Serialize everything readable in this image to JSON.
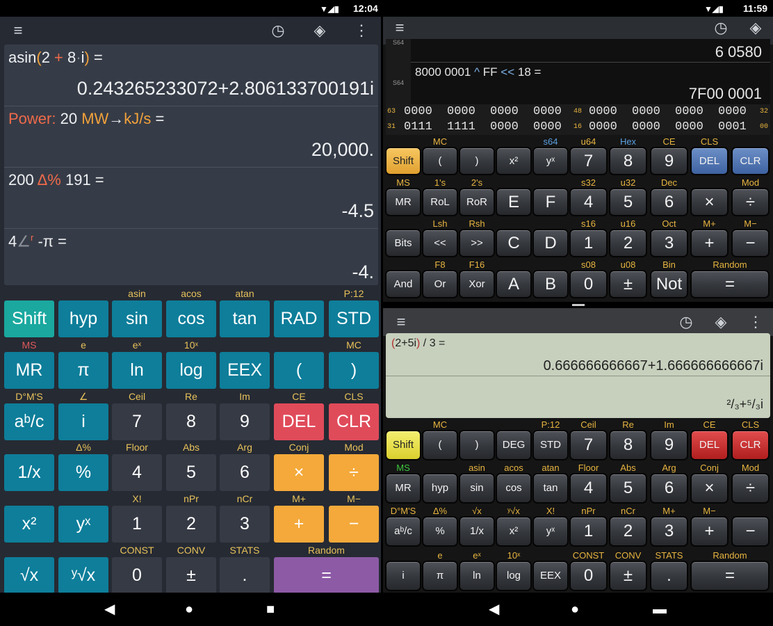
{
  "left": {
    "status": {
      "time": "12:04"
    },
    "toolbar": {
      "menu_icon": "hamburger-icon",
      "history_icon": "clock-icon",
      "layers_icon": "layers-icon",
      "more_icon": "more-vert-icon"
    },
    "display": [
      {
        "parts": [
          {
            "t": "asin",
            "c": "#eef0f2"
          },
          {
            "t": "(",
            "c": "#f2a13b"
          },
          {
            "t": "2 ",
            "c": "#eef0f2"
          },
          {
            "t": "+",
            "c": "#ef6a4a"
          },
          {
            "t": " 8",
            "c": "#eef0f2"
          },
          {
            "t": "·",
            "c": "#8b8f96"
          },
          {
            "t": "i",
            "c": "#eef0f2"
          },
          {
            "t": ")",
            "c": "#f2a13b"
          },
          {
            "t": " =",
            "c": "#eef0f2"
          }
        ],
        "result": "0.243265233072+2.806133700191i"
      },
      {
        "parts": [
          {
            "t": "Power:",
            "c": "#ef6a4a"
          },
          {
            "t": " 20 ",
            "c": "#eef0f2"
          },
          {
            "t": "MW",
            "c": "#f2a13b"
          },
          {
            "t": "→",
            "c": "#eef0f2"
          },
          {
            "t": "kJ/s",
            "c": "#f2a13b"
          },
          {
            "t": " =",
            "c": "#eef0f2"
          }
        ],
        "result": "20,000."
      },
      {
        "parts": [
          {
            "t": "200 ",
            "c": "#eef0f2"
          },
          {
            "t": "Δ%",
            "c": "#ef6a4a"
          },
          {
            "t": " 191 =",
            "c": "#eef0f2"
          }
        ],
        "result": "-4.5"
      },
      {
        "parts": [
          {
            "t": "4",
            "c": "#eef0f2"
          },
          {
            "t": "∠",
            "c": "#8b8f96"
          },
          {
            "t": "r",
            "c": "#ef6a4a",
            "sup": true
          },
          {
            "t": " -π =",
            "c": "#eef0f2"
          }
        ],
        "result": "-4."
      }
    ],
    "rows": [
      {
        "labels": [
          [
            "",
            ""
          ],
          [
            "",
            ""
          ],
          [
            "asin",
            "#e8c25a"
          ],
          [
            "acos",
            "#e8c25a"
          ],
          [
            "atan",
            "#e8c25a"
          ],
          [
            "",
            ""
          ],
          [
            "P:12",
            "#e8c25a"
          ]
        ],
        "buttons": [
          [
            "Shift",
            "#1aa89f"
          ],
          [
            "hyp",
            "#0e7e9a"
          ],
          [
            "sin",
            "#0e7e9a"
          ],
          [
            "cos",
            "#0e7e9a"
          ],
          [
            "tan",
            "#0e7e9a"
          ],
          [
            "RAD",
            "#0e7e9a"
          ],
          [
            "STD",
            "#0e7e9a"
          ]
        ]
      },
      {
        "labels": [
          [
            "MS",
            "#e05a5a"
          ],
          [
            "e",
            "#e8c25a"
          ],
          [
            "eˣ",
            "#e8c25a"
          ],
          [
            "10ˣ",
            "#e8c25a"
          ],
          [
            "",
            ""
          ],
          [
            "",
            ""
          ],
          [
            "MC",
            "#e8c25a"
          ]
        ],
        "buttons": [
          [
            "MR",
            "#0e7e9a"
          ],
          [
            "π",
            "#0e7e9a"
          ],
          [
            "ln",
            "#0e7e9a"
          ],
          [
            "log",
            "#0e7e9a"
          ],
          [
            "EEX",
            "#0e7e9a"
          ],
          [
            "(",
            "#0e7e9a"
          ],
          [
            ")",
            "#0e7e9a"
          ]
        ]
      },
      {
        "labels": [
          [
            "D°M'S",
            "#e8c25a"
          ],
          [
            "∠",
            "#e8c25a"
          ],
          [
            "Ceil",
            "#e8c25a"
          ],
          [
            "Re",
            "#e8c25a"
          ],
          [
            "Im",
            "#e8c25a"
          ],
          [
            "CE",
            "#e8c25a"
          ],
          [
            "CLS",
            "#e8c25a"
          ]
        ],
        "buttons": [
          [
            "aᵇ/c",
            "#0e7e9a"
          ],
          [
            "i",
            "#0e7e9a"
          ],
          [
            "7",
            "#363a44"
          ],
          [
            "8",
            "#363a44"
          ],
          [
            "9",
            "#363a44"
          ],
          [
            "DEL",
            "#e04b5a"
          ],
          [
            "CLR",
            "#e04b5a"
          ]
        ]
      },
      {
        "labels": [
          [
            "",
            ""
          ],
          [
            "Δ%",
            "#e8c25a"
          ],
          [
            "Floor",
            "#e8c25a"
          ],
          [
            "Abs",
            "#e8c25a"
          ],
          [
            "Arg",
            "#e8c25a"
          ],
          [
            "Conj",
            "#e8c25a"
          ],
          [
            "Mod",
            "#e8c25a"
          ]
        ],
        "buttons": [
          [
            "1/x",
            "#0e7e9a"
          ],
          [
            "%",
            "#0e7e9a"
          ],
          [
            "4",
            "#363a44"
          ],
          [
            "5",
            "#363a44"
          ],
          [
            "6",
            "#363a44"
          ],
          [
            "×",
            "#f4a93a"
          ],
          [
            "÷",
            "#f4a93a"
          ]
        ]
      },
      {
        "labels": [
          [
            "",
            ""
          ],
          [
            "",
            ""
          ],
          [
            "X!",
            "#e8c25a"
          ],
          [
            "nPr",
            "#e8c25a"
          ],
          [
            "nCr",
            "#e8c25a"
          ],
          [
            "M+",
            "#e8c25a"
          ],
          [
            "M−",
            "#e8c25a"
          ]
        ],
        "buttons": [
          [
            "x²",
            "#0e7e9a"
          ],
          [
            "yˣ",
            "#0e7e9a"
          ],
          [
            "1",
            "#363a44"
          ],
          [
            "2",
            "#363a44"
          ],
          [
            "3",
            "#363a44"
          ],
          [
            "+",
            "#f4a93a"
          ],
          [
            "−",
            "#f4a93a"
          ]
        ]
      },
      {
        "labels": [
          [
            "",
            ""
          ],
          [
            "",
            ""
          ],
          [
            "CONST",
            "#e8c25a"
          ],
          [
            "CONV",
            "#e8c25a"
          ],
          [
            "STATS",
            "#e8c25a"
          ],
          [
            "Random",
            "#e8c25a"
          ],
          [
            "",
            ""
          ]
        ],
        "buttons": [
          [
            "√x",
            "#0e7e9a"
          ],
          [
            "ʸ√x",
            "#0e7e9a"
          ],
          [
            "0",
            "#363a44"
          ],
          [
            "±",
            "#363a44"
          ],
          [
            ".",
            "#363a44"
          ],
          [
            "=",
            "#8d5aa6"
          ]
        ]
      }
    ],
    "nav": {
      "back": "◀",
      "home": "●",
      "recent": "■"
    }
  },
  "topright": {
    "status": {
      "time": "11:59"
    },
    "display": {
      "s64_a": "S64",
      "line1": "6 0580",
      "expr": [
        {
          "t": "8000 0001 ",
          "c": "#e6e6e6"
        },
        {
          "t": "^",
          "c": "#7fb0e6"
        },
        {
          "t": " FF ",
          "c": "#e6e6e6"
        },
        {
          "t": "<<",
          "c": "#7fb0e6"
        },
        {
          "t": " 18 =",
          "c": "#e6e6e6"
        }
      ],
      "s64_b": "S64",
      "result": "7F00 0001"
    },
    "bits": {
      "row1": {
        "l": "63",
        "a": "0000",
        "b": "0000",
        "c": "0000",
        "d": "0000",
        "m": "48",
        "e": "0000",
        "f": "0000",
        "g": "0000",
        "h": "0000",
        "r": "32"
      },
      "row2": {
        "l": "31",
        "a": "0111",
        "b": "1111",
        "c": "0000",
        "d": "0000",
        "m": "16",
        "e": "0000",
        "f": "0000",
        "g": "0000",
        "h": "0001",
        "r": "00"
      }
    },
    "rows": [
      {
        "labels": [
          [
            "",
            ""
          ],
          [
            "MC",
            "#e8b540"
          ],
          [
            "",
            ""
          ],
          [
            "",
            ""
          ],
          [
            "s64",
            "#5aa0e0"
          ],
          [
            "u64",
            "#e8b540"
          ],
          [
            "Hex",
            "#5aa0e0"
          ],
          [
            "CE",
            "#e8b540"
          ],
          [
            "CLS",
            "#e8b540"
          ]
        ],
        "buttons": [
          [
            "Shift",
            "y"
          ],
          [
            "(",
            ""
          ],
          [
            ")",
            ""
          ],
          [
            "x²",
            ""
          ],
          [
            "yˣ",
            ""
          ],
          [
            "7",
            "num"
          ],
          [
            "8",
            "num"
          ],
          [
            "9",
            "num"
          ],
          [
            "DEL",
            "b"
          ],
          [
            "CLR",
            "b"
          ]
        ]
      },
      {
        "labels": [
          [
            "MS",
            "#e8b540"
          ],
          [
            "1's",
            "#e8b540"
          ],
          [
            "2's",
            "#e8b540"
          ],
          [
            "",
            ""
          ],
          [
            "",
            ""
          ],
          [
            "s32",
            "#e8b540"
          ],
          [
            "u32",
            "#e8b540"
          ],
          [
            "Dec",
            "#e8b540"
          ],
          [
            "",
            ""
          ],
          [
            "Mod",
            "#e8b540"
          ]
        ],
        "buttons": [
          [
            "MR",
            ""
          ],
          [
            "RoL",
            ""
          ],
          [
            "RoR",
            ""
          ],
          [
            "E",
            "num"
          ],
          [
            "F",
            "num"
          ],
          [
            "4",
            "num"
          ],
          [
            "5",
            "num"
          ],
          [
            "6",
            "num"
          ],
          [
            "×",
            "num"
          ],
          [
            "÷",
            "num"
          ]
        ]
      },
      {
        "labels": [
          [
            "",
            ""
          ],
          [
            "Lsh",
            "#e8b540"
          ],
          [
            "Rsh",
            "#e8b540"
          ],
          [
            "",
            ""
          ],
          [
            "",
            ""
          ],
          [
            "s16",
            "#e8b540"
          ],
          [
            "u16",
            "#e8b540"
          ],
          [
            "Oct",
            "#e8b540"
          ],
          [
            "M+",
            "#e8b540"
          ],
          [
            "M−",
            "#e8b540"
          ]
        ],
        "buttons": [
          [
            "Bits",
            ""
          ],
          [
            "<<",
            ""
          ],
          [
            ">>",
            ""
          ],
          [
            "C",
            "num"
          ],
          [
            "D",
            "num"
          ],
          [
            "1",
            "num"
          ],
          [
            "2",
            "num"
          ],
          [
            "3",
            "num"
          ],
          [
            "+",
            "num"
          ],
          [
            "−",
            "num"
          ]
        ]
      },
      {
        "labels": [
          [
            "",
            ""
          ],
          [
            "F8",
            "#e8b540"
          ],
          [
            "F16",
            "#e8b540"
          ],
          [
            "",
            ""
          ],
          [
            "",
            ""
          ],
          [
            "s08",
            "#e8b540"
          ],
          [
            "u08",
            "#e8b540"
          ],
          [
            "Bin",
            "#e8b540"
          ],
          [
            "Random",
            "#e8b540"
          ]
        ],
        "buttons": [
          [
            "And",
            ""
          ],
          [
            "Or",
            ""
          ],
          [
            "Xor",
            ""
          ],
          [
            "A",
            "num"
          ],
          [
            "B",
            "num"
          ],
          [
            "0",
            "num"
          ],
          [
            "±",
            "num"
          ],
          [
            "Not",
            "num"
          ],
          [
            "=",
            "num"
          ]
        ]
      }
    ]
  },
  "bottomright": {
    "display": {
      "expr": [
        {
          "t": "(",
          "c": "#b03030"
        },
        {
          "t": "2+5i",
          "c": "#222"
        },
        {
          "t": ")",
          "c": "#b03030"
        },
        {
          "t": " / 3 =",
          "c": "#222"
        }
      ],
      "result": "0.666666666667+1.666666666667i",
      "frac": "²/₃+⁵/₃i"
    },
    "rows": [
      {
        "labels": [
          [
            "",
            ""
          ],
          [
            "MC",
            "#e8b540"
          ],
          [
            "",
            ""
          ],
          [
            "",
            ""
          ],
          [
            "P:12",
            "#e8b540"
          ],
          [
            "Ceil",
            "#e8b540"
          ],
          [
            "Re",
            "#e8b540"
          ],
          [
            "Im",
            "#e8b540"
          ],
          [
            "CE",
            "#e8b540"
          ],
          [
            "CLS",
            "#e8b540"
          ]
        ],
        "buttons": [
          [
            "Shift",
            "yy"
          ],
          [
            "(",
            ""
          ],
          [
            ")",
            ""
          ],
          [
            "DEG",
            ""
          ],
          [
            "STD",
            ""
          ],
          [
            "7",
            "num"
          ],
          [
            "8",
            "num"
          ],
          [
            "9",
            "num"
          ],
          [
            "DEL",
            "r"
          ],
          [
            "CLR",
            "r"
          ]
        ]
      },
      {
        "labels": [
          [
            "MS",
            "#3cc83c"
          ],
          [
            "",
            ""
          ],
          [
            "asin",
            "#e8b540"
          ],
          [
            "acos",
            "#e8b540"
          ],
          [
            "atan",
            "#e8b540"
          ],
          [
            "Floor",
            "#e8b540"
          ],
          [
            "Abs",
            "#e8b540"
          ],
          [
            "Arg",
            "#e8b540"
          ],
          [
            "Conj",
            "#e8b540"
          ],
          [
            "Mod",
            "#e8b540"
          ]
        ],
        "buttons": [
          [
            "MR",
            ""
          ],
          [
            "hyp",
            ""
          ],
          [
            "sin",
            ""
          ],
          [
            "cos",
            ""
          ],
          [
            "tan",
            ""
          ],
          [
            "4",
            "num"
          ],
          [
            "5",
            "num"
          ],
          [
            "6",
            "num"
          ],
          [
            "×",
            "num"
          ],
          [
            "÷",
            "num"
          ]
        ]
      },
      {
        "labels": [
          [
            "D°M'S",
            "#e8b540"
          ],
          [
            "Δ%",
            "#e8b540"
          ],
          [
            "√x",
            "#e8b540"
          ],
          [
            "ʸ√x",
            "#e8b540"
          ],
          [
            "X!",
            "#e8b540"
          ],
          [
            "nPr",
            "#e8b540"
          ],
          [
            "nCr",
            "#e8b540"
          ],
          [
            "M+",
            "#e8b540"
          ],
          [
            "M−",
            "#e8b540"
          ],
          [
            "",
            ""
          ]
        ],
        "buttons": [
          [
            "aᵇ/c",
            ""
          ],
          [
            "%",
            ""
          ],
          [
            "1/x",
            ""
          ],
          [
            "x²",
            ""
          ],
          [
            "yˣ",
            ""
          ],
          [
            "1",
            "num"
          ],
          [
            "2",
            "num"
          ],
          [
            "3",
            "num"
          ],
          [
            "+",
            "num"
          ],
          [
            "−",
            "num"
          ]
        ]
      },
      {
        "labels": [
          [
            "",
            ""
          ],
          [
            "e",
            "#e8b540"
          ],
          [
            "eˣ",
            "#e8b540"
          ],
          [
            "10ˣ",
            "#e8b540"
          ],
          [
            "",
            ""
          ],
          [
            "CONST",
            "#e8b540"
          ],
          [
            "CONV",
            "#e8b540"
          ],
          [
            "STATS",
            "#e8b540"
          ],
          [
            "Random",
            "#e8b540"
          ]
        ],
        "buttons": [
          [
            "i",
            ""
          ],
          [
            "π",
            ""
          ],
          [
            "ln",
            ""
          ],
          [
            "log",
            ""
          ],
          [
            "EEX",
            ""
          ],
          [
            "0",
            "num"
          ],
          [
            "±",
            "num"
          ],
          [
            ".",
            "num"
          ],
          [
            "=",
            "num"
          ]
        ]
      }
    ],
    "nav": {
      "back": "◀",
      "home": "●",
      "recent": "▬"
    }
  }
}
